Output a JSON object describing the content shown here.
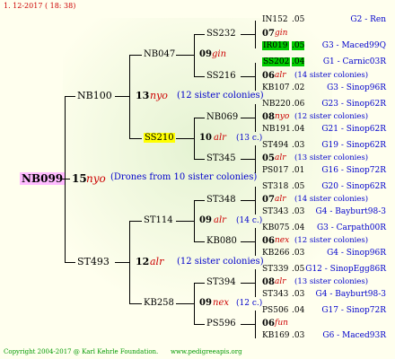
{
  "date": "1. 12-2017 ( 18: 38)",
  "copyright": "Copyright 2004-2017 @ Karl Kehrle Foundation.",
  "website": "www.pedigreeapis.org",
  "root": {
    "name": "NB099",
    "year": "15",
    "origin": "nyo",
    "note": "(Drones from 10 sister colonies)"
  },
  "gen2": [
    {
      "name": "NB100",
      "year": "13",
      "origin": "nyo",
      "note": "(12 sister colonies)"
    },
    {
      "name": "ST493",
      "year": "12",
      "origin": "alr",
      "note": "(12 sister colonies)"
    }
  ],
  "gen3": [
    {
      "name": "NB047",
      "year": "09",
      "origin": "gin"
    },
    {
      "name": "SS210",
      "year": "10",
      "origin": "alr",
      "note": "(13 c.)"
    },
    {
      "name": "ST114",
      "year": "09",
      "origin": "alr",
      "note": "(14 c.)"
    },
    {
      "name": "KB258",
      "year": "09",
      "origin": "nex",
      "note": "(12 c.)"
    }
  ],
  "gen4": [
    "SS232",
    "SS216",
    "NB069",
    "ST345",
    "ST348",
    "KB080",
    "ST394",
    "PS596"
  ],
  "gen5": [
    {
      "id": "IN152",
      "yr": ".05",
      "code": "G2 - Ren"
    },
    {
      "id": "07",
      "ori": "gin"
    },
    {
      "id": "IR019",
      "yr": ".05",
      "code": "G3 - Maced99Q"
    },
    {
      "id": "SS202",
      "yr": ".04",
      "code": "G1 - Carnic03R"
    },
    {
      "id": "06",
      "ori": "alr",
      "sis": "(14 sister colonies)"
    },
    {
      "id": "KB107",
      "yr": ".02",
      "code": "G3 - Sinop96R"
    },
    {
      "id": "NB220",
      "yr": ".06",
      "code": "G23 - Sinop62R"
    },
    {
      "id": "08",
      "ori": "nyo",
      "sis": "(12 sister colonies)"
    },
    {
      "id": "NB191",
      "yr": ".04",
      "code": "G21 - Sinop62R"
    },
    {
      "id": "ST494",
      "yr": ".03",
      "code": "G19 - Sinop62R"
    },
    {
      "id": "05",
      "ori": "alr",
      "sis": "(13 sister colonies)"
    },
    {
      "id": "PS017",
      "yr": ".01",
      "code": "G16 - Sinop72R"
    },
    {
      "id": "ST318",
      "yr": ".05",
      "code": "G20 - Sinop62R"
    },
    {
      "id": "07",
      "ori": "alr",
      "sis": "(14 sister colonies)"
    },
    {
      "id": "ST343",
      "yr": ".03",
      "code": "G4 - Bayburt98-3"
    },
    {
      "id": "KB075",
      "yr": ".04",
      "code": "G3 - Carpath00R"
    },
    {
      "id": "06",
      "ori": "nex",
      "sis": "(12 sister colonies)"
    },
    {
      "id": "KB266",
      "yr": ".03",
      "code": "G4 - Sinop96R"
    },
    {
      "id": "ST339",
      "yr": ".05",
      "code": "G12 - SinopEgg86R"
    },
    {
      "id": "08",
      "ori": "alr",
      "sis": "(13 sister colonies)"
    },
    {
      "id": "ST343",
      "yr": ".03",
      "code": "G4 - Bayburt98-3"
    },
    {
      "id": "PS506",
      "yr": ".04",
      "code": "G17 - Sinop72R"
    },
    {
      "id": "06",
      "ori": "fun"
    },
    {
      "id": "KB169",
      "yr": ".03",
      "code": "G6 - Maced93R"
    }
  ]
}
